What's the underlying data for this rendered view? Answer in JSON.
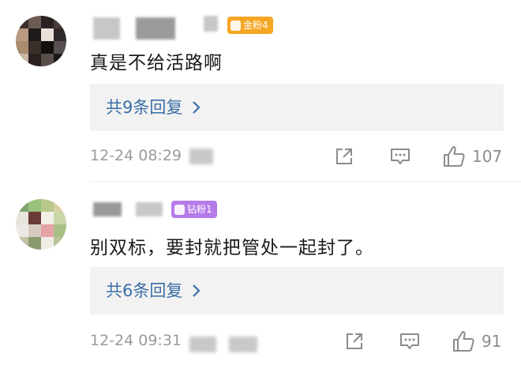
{
  "comments": [
    {
      "badge": "金粉4",
      "badge_color": "#f5a623",
      "text": "真是不给活路啊",
      "replies_label": "共9条回复",
      "time": "12-24 08:29",
      "likes": "107"
    },
    {
      "badge": "钻粉1",
      "badge_color": "#b57be8",
      "text": "别双标，要封就把管处一起封了。",
      "replies_label": "共6条回复",
      "time": "12-24 09:31",
      "likes": "91"
    }
  ],
  "icons": {
    "share": "share-external-icon",
    "comment": "comment-bubble-icon",
    "like": "thumbs-up-icon",
    "chevron": "chevron-right-icon"
  }
}
